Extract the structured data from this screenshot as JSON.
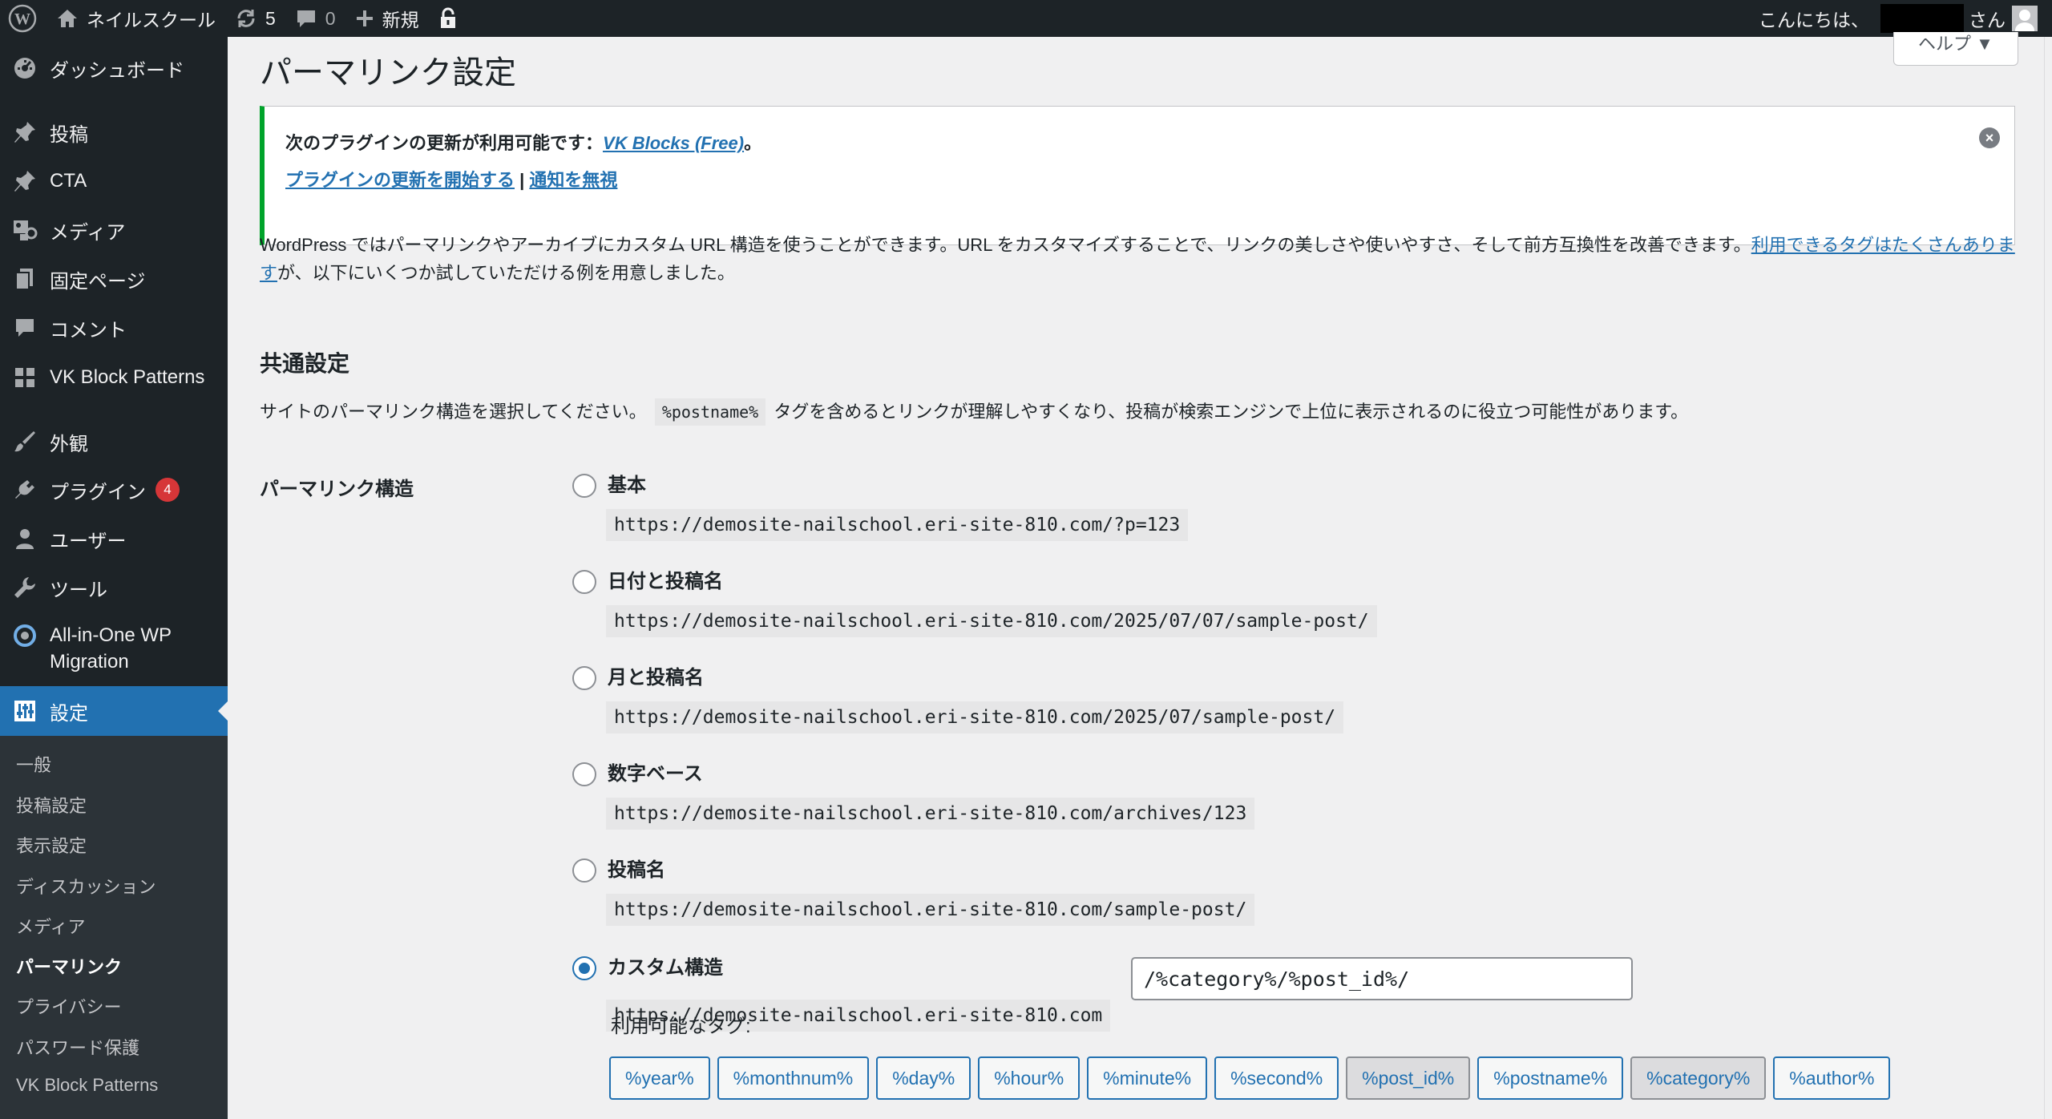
{
  "adminbar": {
    "site_name": "ネイルスクール",
    "updates_count": "5",
    "comments_count": "0",
    "new_label": "新規",
    "greeting": "こんにちは、",
    "greeting_suffix": "さん"
  },
  "sidebar": {
    "items": [
      {
        "label": "ダッシュボード",
        "icon": "dashboard-icon"
      },
      {
        "label": "投稿",
        "icon": "pin-icon"
      },
      {
        "label": "CTA",
        "icon": "pin-icon"
      },
      {
        "label": "メディア",
        "icon": "media-icon"
      },
      {
        "label": "固定ページ",
        "icon": "page-icon"
      },
      {
        "label": "コメント",
        "icon": "comment-icon"
      },
      {
        "label": "VK Block Patterns",
        "icon": "grid-icon"
      },
      {
        "label": "外観",
        "icon": "brush-icon"
      },
      {
        "label": "プラグイン",
        "icon": "plugin-icon",
        "badge": "4"
      },
      {
        "label": "ユーザー",
        "icon": "user-icon"
      },
      {
        "label": "ツール",
        "icon": "wrench-icon"
      },
      {
        "label": "All-in-One WP",
        "label2": "Migration",
        "icon": "migration-icon"
      },
      {
        "label": "設定",
        "icon": "settings-icon",
        "current": true
      }
    ],
    "submenu": [
      {
        "label": "一般"
      },
      {
        "label": "投稿設定"
      },
      {
        "label": "表示設定"
      },
      {
        "label": "ディスカッション"
      },
      {
        "label": "メディア"
      },
      {
        "label": "パーマリンク",
        "active": true
      },
      {
        "label": "プライバシー"
      },
      {
        "label": "パスワード保護"
      },
      {
        "label": "VK Block Patterns"
      }
    ]
  },
  "main": {
    "help_label": "ヘルプ ▼",
    "page_title": "パーマリンク設定",
    "notice": {
      "text_before": "次のプラグインの更新が利用可能です：",
      "plugin_link": "VK Blocks (Free)",
      "text_after": "。",
      "start_update_link": "プラグインの更新を開始する",
      "separator": " | ",
      "ignore_link": "通知を無視"
    },
    "intro_text": "WordPress ではパーマリンクやアーカイブにカスタム URL 構造を使うことができます。URL をカスタマイズすることで、リンクの美しさや使いやすさ、そして前方互換性を改善できます。",
    "intro_link": "利用できるタグはたくさんあります",
    "intro_after": "が、以下にいくつか試していただける例を用意しました。",
    "section_title": "共通設定",
    "section_desc_before": "サイトのパーマリンク構造を選択してください。",
    "section_desc_code": "%postname%",
    "section_desc_after": "タグを含めるとリンクが理解しやすくなり、投稿が検索エンジンで上位に表示されるのに役立つ可能性があります。",
    "structure_label": "パーマリンク構造",
    "options": [
      {
        "label": "基本",
        "example": "https://demosite-nailschool.eri-site-810.com/?p=123",
        "checked": false
      },
      {
        "label": "日付と投稿名",
        "example": "https://demosite-nailschool.eri-site-810.com/2025/07/07/sample-post/",
        "checked": false
      },
      {
        "label": "月と投稿名",
        "example": "https://demosite-nailschool.eri-site-810.com/2025/07/sample-post/",
        "checked": false
      },
      {
        "label": "数字ベース",
        "example": "https://demosite-nailschool.eri-site-810.com/archives/123",
        "checked": false
      },
      {
        "label": "投稿名",
        "example": "https://demosite-nailschool.eri-site-810.com/sample-post/",
        "checked": false
      },
      {
        "label": "カスタム構造",
        "example": "https://demosite-nailschool.eri-site-810.com",
        "checked": true
      }
    ],
    "custom_value": "/%category%/%post_id%/",
    "tags_label": "利用可能なタグ:",
    "tags": [
      {
        "label": "%year%",
        "active": false
      },
      {
        "label": "%monthnum%",
        "active": false
      },
      {
        "label": "%day%",
        "active": false
      },
      {
        "label": "%hour%",
        "active": false
      },
      {
        "label": "%minute%",
        "active": false
      },
      {
        "label": "%second%",
        "active": false
      },
      {
        "label": "%post_id%",
        "active": true
      },
      {
        "label": "%postname%",
        "active": false
      },
      {
        "label": "%category%",
        "active": true
      },
      {
        "label": "%author%",
        "active": false
      }
    ]
  },
  "colors": {
    "admin_dark": "#1d2327",
    "accent_blue": "#2271b1",
    "notice_green": "#00a32a",
    "badge_red": "#d63638"
  }
}
